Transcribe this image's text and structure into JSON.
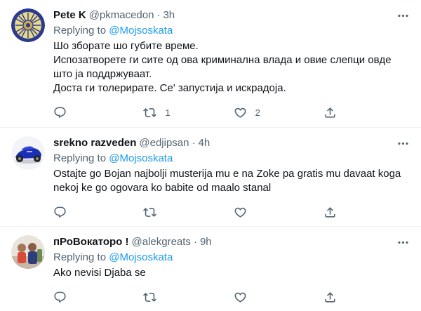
{
  "tweets": [
    {
      "display_name": "Pete K",
      "handle": "@pkmacedon",
      "separator": "·",
      "time": "3h",
      "replying_prefix": "Replying to ",
      "replying_to": "@Mojsoskata",
      "text": "Шо зборате шо губите време.\nИспозатворете ги сите од ова криминална влада и овие слепци овде што ја поддржуваат.\nДоста ги толерирате. Се' запустија и искрадоја.",
      "avatar_icon": "sun-emblem-avatar",
      "actions": {
        "reply_count": "",
        "retweet_count": "1",
        "like_count": "2"
      }
    },
    {
      "display_name": "srekno razveden",
      "handle": "@edjipsan",
      "separator": "·",
      "time": "4h",
      "replying_prefix": "Replying to ",
      "replying_to": "@Mojsoskata",
      "text": "Ostajte go Bojan najbolji musterija mu e na Zoke pa gratis mu davaat koga nekoj ke go ogovara ko babite od maalo stanal",
      "avatar_icon": "motorcycle-avatar",
      "actions": {
        "reply_count": "",
        "retweet_count": "",
        "like_count": ""
      }
    },
    {
      "display_name": "пРоВокаторо !",
      "handle": "@alekgreats",
      "separator": "·",
      "time": "9h",
      "replying_prefix": "Replying to ",
      "replying_to": "@Mojsoskata",
      "text": "Ako nevisi Djaba se",
      "avatar_icon": "person-photo-avatar",
      "actions": {
        "reply_count": "",
        "retweet_count": "",
        "like_count": ""
      }
    }
  ],
  "colors": {
    "link": "#1d9bf0",
    "secondary_text": "#536471",
    "primary_text": "#0f1419",
    "divider": "#eff3f4"
  }
}
